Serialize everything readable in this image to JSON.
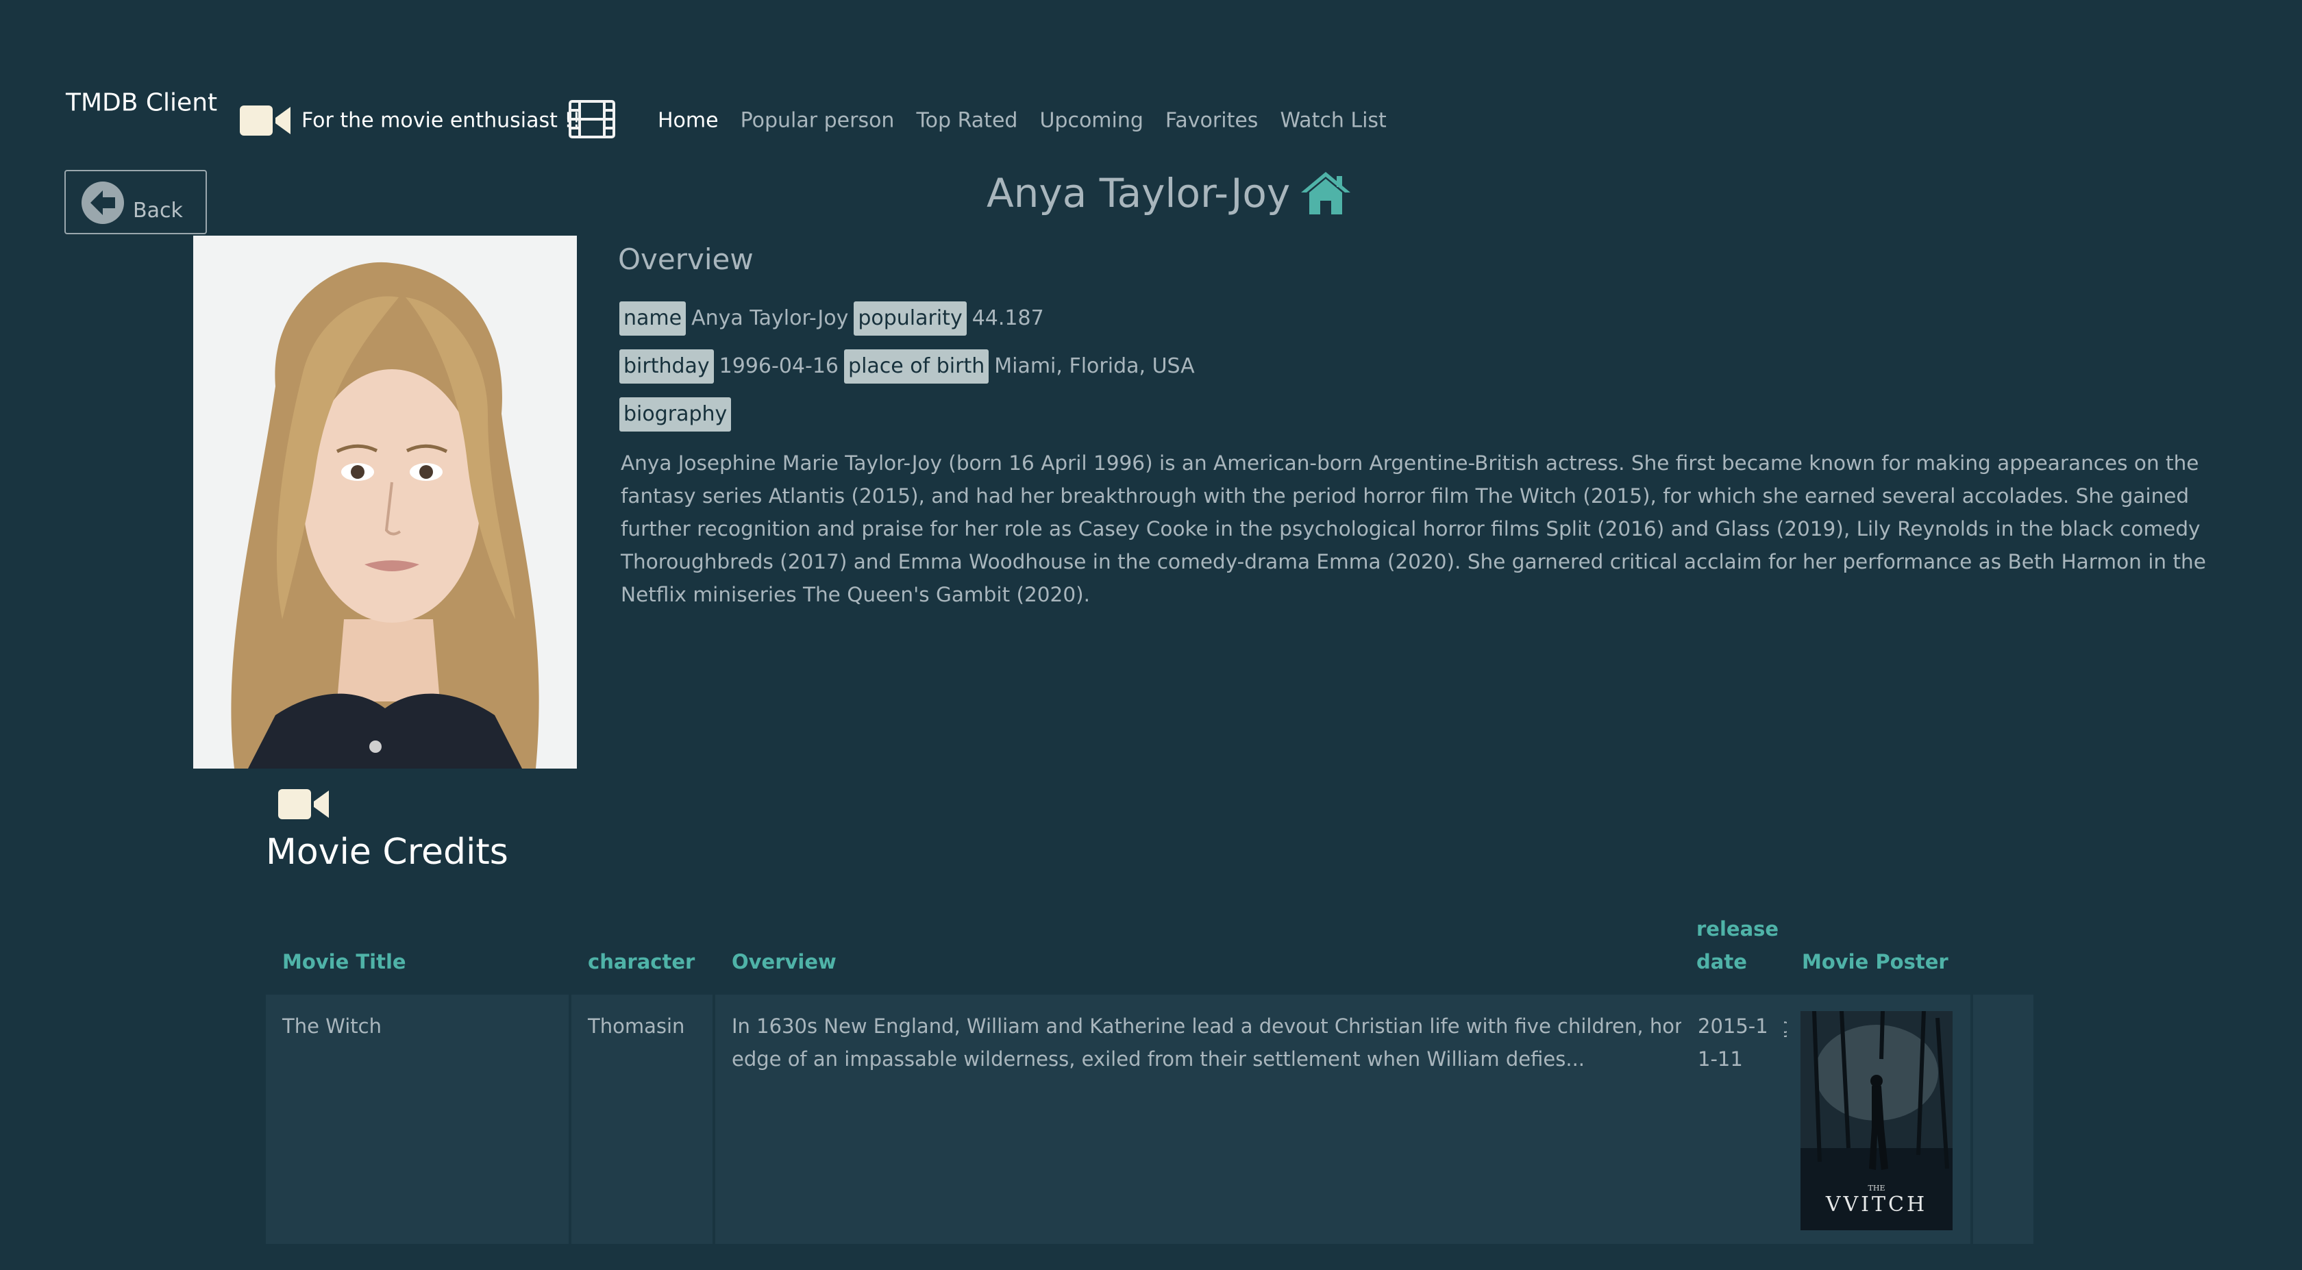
{
  "navbar": {
    "brand": "TMDB Client",
    "tagline": "For the movie enthusiast !!",
    "links": [
      "Home",
      "Popular person",
      "Top Rated",
      "Upcoming",
      "Favorites",
      "Watch List"
    ],
    "active": "Home"
  },
  "back_button": {
    "label": "Back"
  },
  "person": {
    "name": "Anya Taylor-Joy",
    "overview_heading": "Overview",
    "labels": {
      "name": "name",
      "popularity": "popularity",
      "birthday": "birthday",
      "place_of_birth": "place of birth",
      "biography": "biography"
    },
    "values": {
      "name": "Anya Taylor-Joy",
      "popularity": "44.187",
      "birthday": "1996-04-16",
      "place_of_birth": "Miami, Florida, USA"
    },
    "biography": "Anya Josephine Marie Taylor-Joy (born 16 April 1996) is an American-born Argentine-British actress. She first became known for making appearances on the fantasy series Atlantis (2015), and had her breakthrough with the period horror film The Witch (2015), for which she earned several accolades. She gained further recognition and praise for her role as Casey Cooke in the psychological horror films Split (2016) and Glass (2019), Lily Reynolds in the black comedy Thoroughbreds (2017) and Emma Woodhouse in the comedy-drama Emma (2020). She garnered critical acclaim for her performance as Beth Harmon in the Netflix miniseries The Queen's Gambit (2020)."
  },
  "credits": {
    "heading": "Movie Credits",
    "columns": {
      "title": "Movie Title",
      "character": "character",
      "overview": "Overview",
      "release_date": "release date",
      "poster": "Movie Poster"
    },
    "rows": [
      {
        "title": "The Witch",
        "character": "Thomasin",
        "overview": "In 1630s New England, William and Katherine lead a devout Christian life with five children, homesteading on the edge of an impassable wilderness, exiled from their settlement when William defies...",
        "release_date": "2015-11-11",
        "poster_text_small": "THE",
        "poster_text": "VVITCH"
      }
    ]
  },
  "colors": {
    "background": "#193440",
    "accent": "#4fb3a8",
    "chip": "#b8c6c8",
    "row": "#213d4a"
  },
  "icons": [
    "video-camera-icon",
    "film-icon",
    "arrow-left-circle-icon",
    "home-icon"
  ]
}
